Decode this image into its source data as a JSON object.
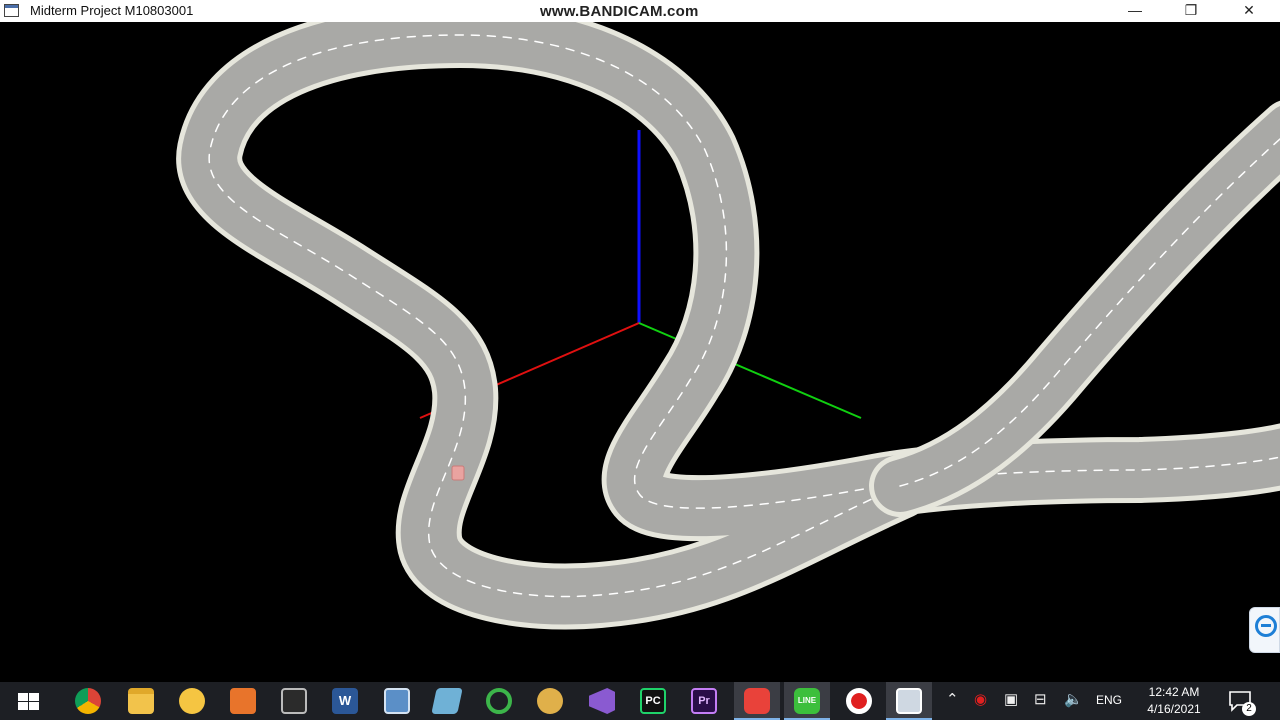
{
  "window": {
    "title": "Midterm Project M10803001",
    "watermark": "www.BANDICAM.com",
    "controls": {
      "minimize": "—",
      "maximize": "❐",
      "close": "✕"
    }
  },
  "scene": {
    "description_free": "",
    "axes": {
      "x_color": "#e01010",
      "y_color": "#10d010",
      "z_color": "#1010ff"
    },
    "road_color": "#a9a9a6",
    "road_edge_color": "#e8e8e0",
    "lane_marking_color": "#ffffff",
    "car_color": "#e9a3a0"
  },
  "taskbar": {
    "pinned": [
      {
        "name": "start-button",
        "icon": "windows-logo"
      },
      {
        "name": "chrome",
        "icon": "chrome-icon",
        "color": "#db4437"
      },
      {
        "name": "file-explorer",
        "icon": "folder-icon",
        "color": "#f2c34b"
      },
      {
        "name": "emoji-app",
        "icon": "smiley-icon",
        "color": "#f5c542"
      },
      {
        "name": "office-app",
        "icon": "office-icon",
        "color": "#e8742b"
      },
      {
        "name": "terminal",
        "icon": "terminal-icon",
        "color": "#2b2b2b"
      },
      {
        "name": "word",
        "icon": "word-icon",
        "color": "#2b5797",
        "label": "W"
      },
      {
        "name": "connect-app",
        "icon": "connect-icon",
        "color": "#5b8fc7"
      },
      {
        "name": "paint-app",
        "icon": "paint-icon",
        "color": "#6fb1d6"
      },
      {
        "name": "sync-app",
        "icon": "sync-icon",
        "color": "#3cb54a"
      },
      {
        "name": "game-app",
        "icon": "game-icon",
        "color": "#e0b04a"
      },
      {
        "name": "visual-studio",
        "icon": "visual-studio-icon",
        "color": "#8a5ad1"
      },
      {
        "name": "pycharm",
        "icon": "pycharm-icon",
        "color": "#1fd36a",
        "label": "PC"
      },
      {
        "name": "premiere",
        "icon": "premiere-icon",
        "color": "#2a0e48",
        "label": "Pr"
      },
      {
        "name": "bandicam-app",
        "icon": "bandicam-icon",
        "color": "#e9423a"
      },
      {
        "name": "line-app",
        "icon": "line-icon",
        "color": "#3cbf3c",
        "label": "LINE"
      },
      {
        "name": "record-app",
        "icon": "record-icon",
        "color": "#e02020"
      },
      {
        "name": "midterm-window",
        "icon": "window-icon",
        "color": "#cfd8e2"
      }
    ],
    "tray": {
      "language": "ENG",
      "time": "12:42 AM",
      "date": "4/16/2021",
      "notification_count": "2"
    }
  }
}
